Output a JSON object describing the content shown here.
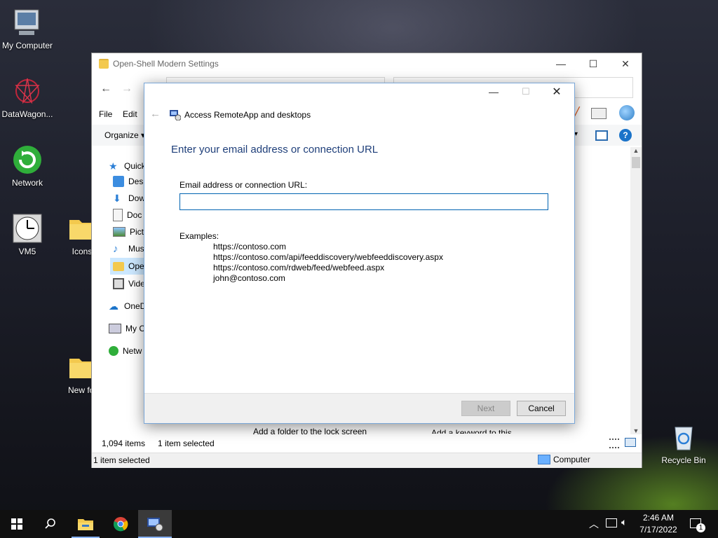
{
  "desktop": {
    "icons": [
      {
        "label": "My Computer"
      },
      {
        "label": "DataWagon..."
      },
      {
        "label": "Network"
      },
      {
        "label": "VM5"
      },
      {
        "label": "Icons"
      },
      {
        "label": "New fol"
      },
      {
        "label": "Recycle Bin"
      }
    ]
  },
  "explorer": {
    "title": "Open-Shell Modern Settings",
    "menu": {
      "file": "File",
      "edit": "Edit"
    },
    "organize": "Organize",
    "nav": [
      {
        "label": "Quick",
        "icon": "star-icon"
      },
      {
        "label": "Desk",
        "icon": "desktop-icon"
      },
      {
        "label": "Dow",
        "icon": "download-icon"
      },
      {
        "label": "Doc",
        "icon": "document-icon"
      },
      {
        "label": "Pict",
        "icon": "picture-icon"
      },
      {
        "label": "Musi",
        "icon": "music-icon"
      },
      {
        "label": "Ope",
        "icon": "folder-icon"
      },
      {
        "label": "Vide",
        "icon": "video-icon"
      },
      {
        "label": "OneD",
        "icon": "cloud-icon"
      },
      {
        "label": "My Co",
        "icon": "computer-icon"
      },
      {
        "label": "Netw",
        "icon": "network-icon"
      }
    ],
    "content_label_1": "Add a folder to the lock screen",
    "content_label_2": "Add a keyword to this device",
    "status_items": "1,094 items",
    "status_selected": "1 item selected",
    "bottom_status": "1 item selected",
    "bottom_location": "Computer"
  },
  "dialog": {
    "app_title": "Access RemoteApp and desktops",
    "heading": "Enter your email address or connection URL",
    "field_label": "Email address or connection URL:",
    "field_value": "",
    "examples_label": "Examples:",
    "examples": [
      "https://contoso.com",
      "https://contoso.com/api/feeddiscovery/webfeeddiscovery.aspx",
      "https://contoso.com/rdweb/feed/webfeed.aspx",
      "john@contoso.com"
    ],
    "next_label": "Next",
    "cancel_label": "Cancel"
  },
  "taskbar": {
    "time": "2:46 AM",
    "date": "7/17/2022",
    "notification_count": "1"
  },
  "colors": {
    "dialog_heading": "#1f3f7a",
    "input_border": "#0063b1",
    "taskbar": "#101010"
  }
}
